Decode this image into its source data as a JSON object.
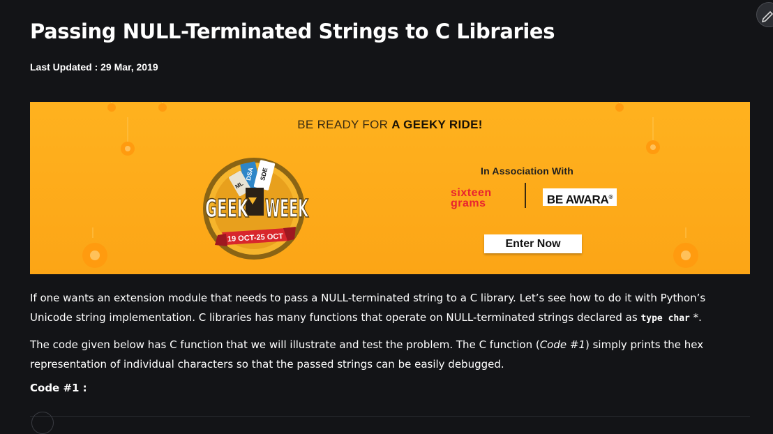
{
  "article": {
    "title": "Passing NULL-Terminated Strings to C Libraries",
    "last_updated": "Last Updated : 29 Mar, 2019"
  },
  "banner": {
    "tagline_pre": "BE READY FOR ",
    "tagline_bold": "A GEEKY RIDE!",
    "event_name_left": "GEEK",
    "event_name_right": "WEEK",
    "dates": "19 OCT-25 OCT",
    "tickets": [
      "DSA",
      "SDE",
      "ML"
    ],
    "association": "In Association With",
    "partner1_line1": "sixteen",
    "partner1_line2": "grams",
    "partner2": "BE AWARA",
    "partner2_mark": "®",
    "cta": "Enter Now"
  },
  "body": {
    "p1_a": "If one wants an extension module that needs to pass a NULL-terminated string to a C library. Let’s see how to do it with Python’s Unicode string implementation. C libraries has many functions that operate on NULL-terminated strings declared as ",
    "p1_code": "type char",
    "p1_b": " *.",
    "p2_a": "The code given below has C function that we will illustrate and test the problem. The C function (",
    "p2_ital": "Code #1",
    "p2_b": ") simply prints the hex representation of individual characters so that the passed strings can be easily debugged.",
    "code_heading": "Code #1 :"
  },
  "colors": {
    "page_bg": "#131417",
    "banner_bg": "#fca516",
    "badge_ring": "#7a5a12",
    "ribbon": "#d8262c"
  },
  "icons": {
    "edit": "pencil-icon"
  }
}
